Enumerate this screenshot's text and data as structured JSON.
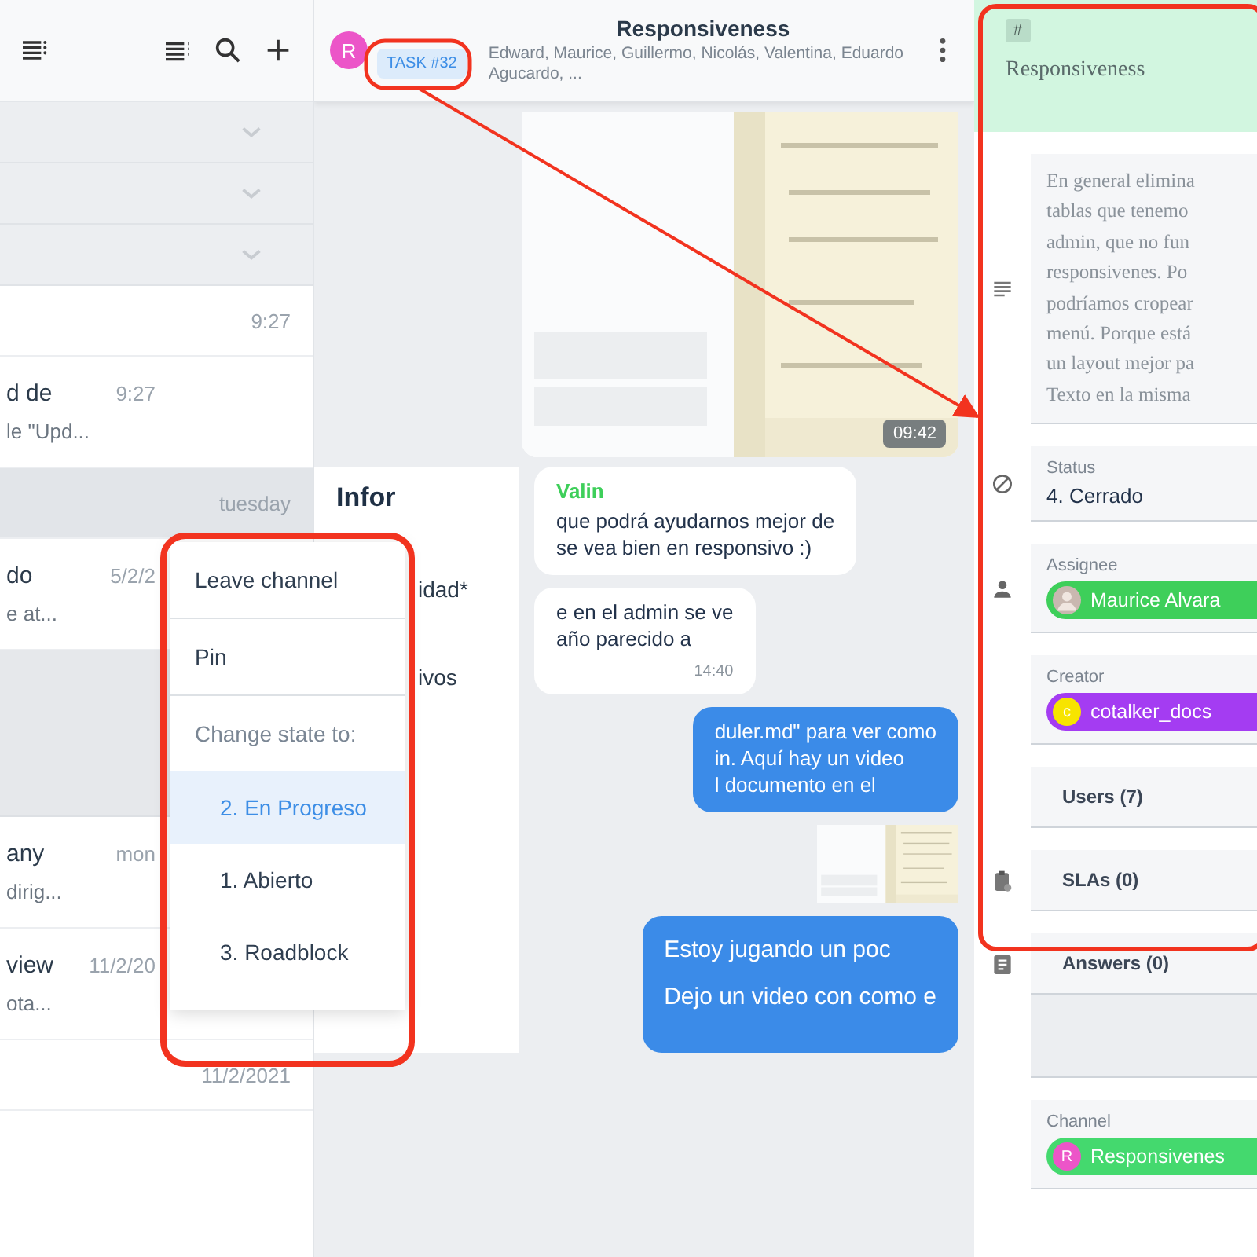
{
  "chat_list": {
    "items": [
      {
        "kind": "section",
        "expanded": false
      },
      {
        "kind": "section",
        "expanded": false
      },
      {
        "kind": "section",
        "expanded": false
      },
      {
        "kind": "chat",
        "time": "9:27",
        "selected": false
      },
      {
        "kind": "chat",
        "title": "d de",
        "time": "9:27",
        "preview": "le \"Upd...",
        "selected": false
      },
      {
        "kind": "chat",
        "time": "tuesday",
        "selected": true
      },
      {
        "kind": "chat",
        "title": "do",
        "time": "5/2/2",
        "preview": "e at...",
        "selected": false
      },
      {
        "kind": "band"
      },
      {
        "kind": "chat",
        "title": "any",
        "time": "mon",
        "preview": "dirig...",
        "selected": false
      },
      {
        "kind": "chat",
        "title": "view",
        "time": "11/2/20",
        "preview": "ota...",
        "selected": false
      },
      {
        "kind": "chat",
        "time": "11/2/2021",
        "selected": false
      }
    ]
  },
  "chat": {
    "header": {
      "avatar": "R",
      "tag": "TASK #32",
      "title": "Responsiveness",
      "members": "Edward, Maurice, Guillermo, Nicolás, Valentina, Eduardo Agucardo, ..."
    },
    "video": {
      "kind": "picture",
      "duration": "09:42"
    },
    "form_fragments": [
      {
        "kind": "heading",
        "text": "Infor"
      },
      {
        "kind": "label",
        "text": "idad*"
      },
      {
        "kind": "label",
        "text": "ivos"
      }
    ],
    "messages": [
      {
        "kind": "incoming",
        "sender": "Valin",
        "lines": [
          "que podrá ayudarnos mejor de",
          "se vea bien en responsivo :)"
        ]
      },
      {
        "kind": "incoming",
        "lines": [
          "e en el admin se ve",
          "año parecido a"
        ],
        "time": "14:40"
      },
      {
        "kind": "outgoing",
        "lines": [
          "duler.md\" para ver como",
          "in. Aquí hay un video",
          "l documento en el"
        ]
      },
      {
        "kind": "video"
      },
      {
        "kind": "outgoing",
        "lines": [
          "Estoy jugando un poc",
          "Dejo un video con como e"
        ]
      }
    ]
  },
  "menu": {
    "items": [
      {
        "kind": "action",
        "label": "Leave channel"
      },
      {
        "kind": "action",
        "label": "Pin"
      },
      {
        "kind": "heading",
        "label": "Change state to:"
      },
      {
        "kind": "state",
        "label": "2. En Progreso",
        "selected": true
      },
      {
        "kind": "state",
        "label": "1. Abierto",
        "selected": false
      },
      {
        "kind": "state",
        "label": "3. Roadblock",
        "selected": false
      }
    ]
  },
  "details": {
    "tag": "#",
    "title": "Responsiveness",
    "description": [
      "En general elimina",
      "tablas que tenemo",
      "admin, que no fun",
      "responsivenes. Po",
      "podríamos cropear",
      "menú. Porque está",
      "un layout mejor pa",
      "Texto en la misma"
    ],
    "fields": [
      {
        "kind": "text",
        "label": "Status",
        "value": "4. Cerrado"
      },
      {
        "kind": "chip",
        "label": "Assignee",
        "value": "Maurice Alvara",
        "color": "#3ecf5a"
      },
      {
        "kind": "chip",
        "label": "Creator",
        "value": "cotalker_docs",
        "color": "#a43cf2",
        "avatar": {
          "kind": "letter",
          "letter": "c",
          "color": "#f7e400"
        }
      },
      {
        "kind": "section",
        "label": "Users (7)"
      },
      {
        "kind": "section",
        "label": "SLAs (0)"
      },
      {
        "kind": "section",
        "label": "Answers (0)"
      },
      {
        "kind": "band"
      },
      {
        "kind": "chip",
        "label": "Channel",
        "value": "Responsivenes",
        "color": "#44d96e",
        "avatar": {
          "kind": "letter",
          "letter": "R",
          "color": "#ec55c8"
        }
      }
    ]
  }
}
